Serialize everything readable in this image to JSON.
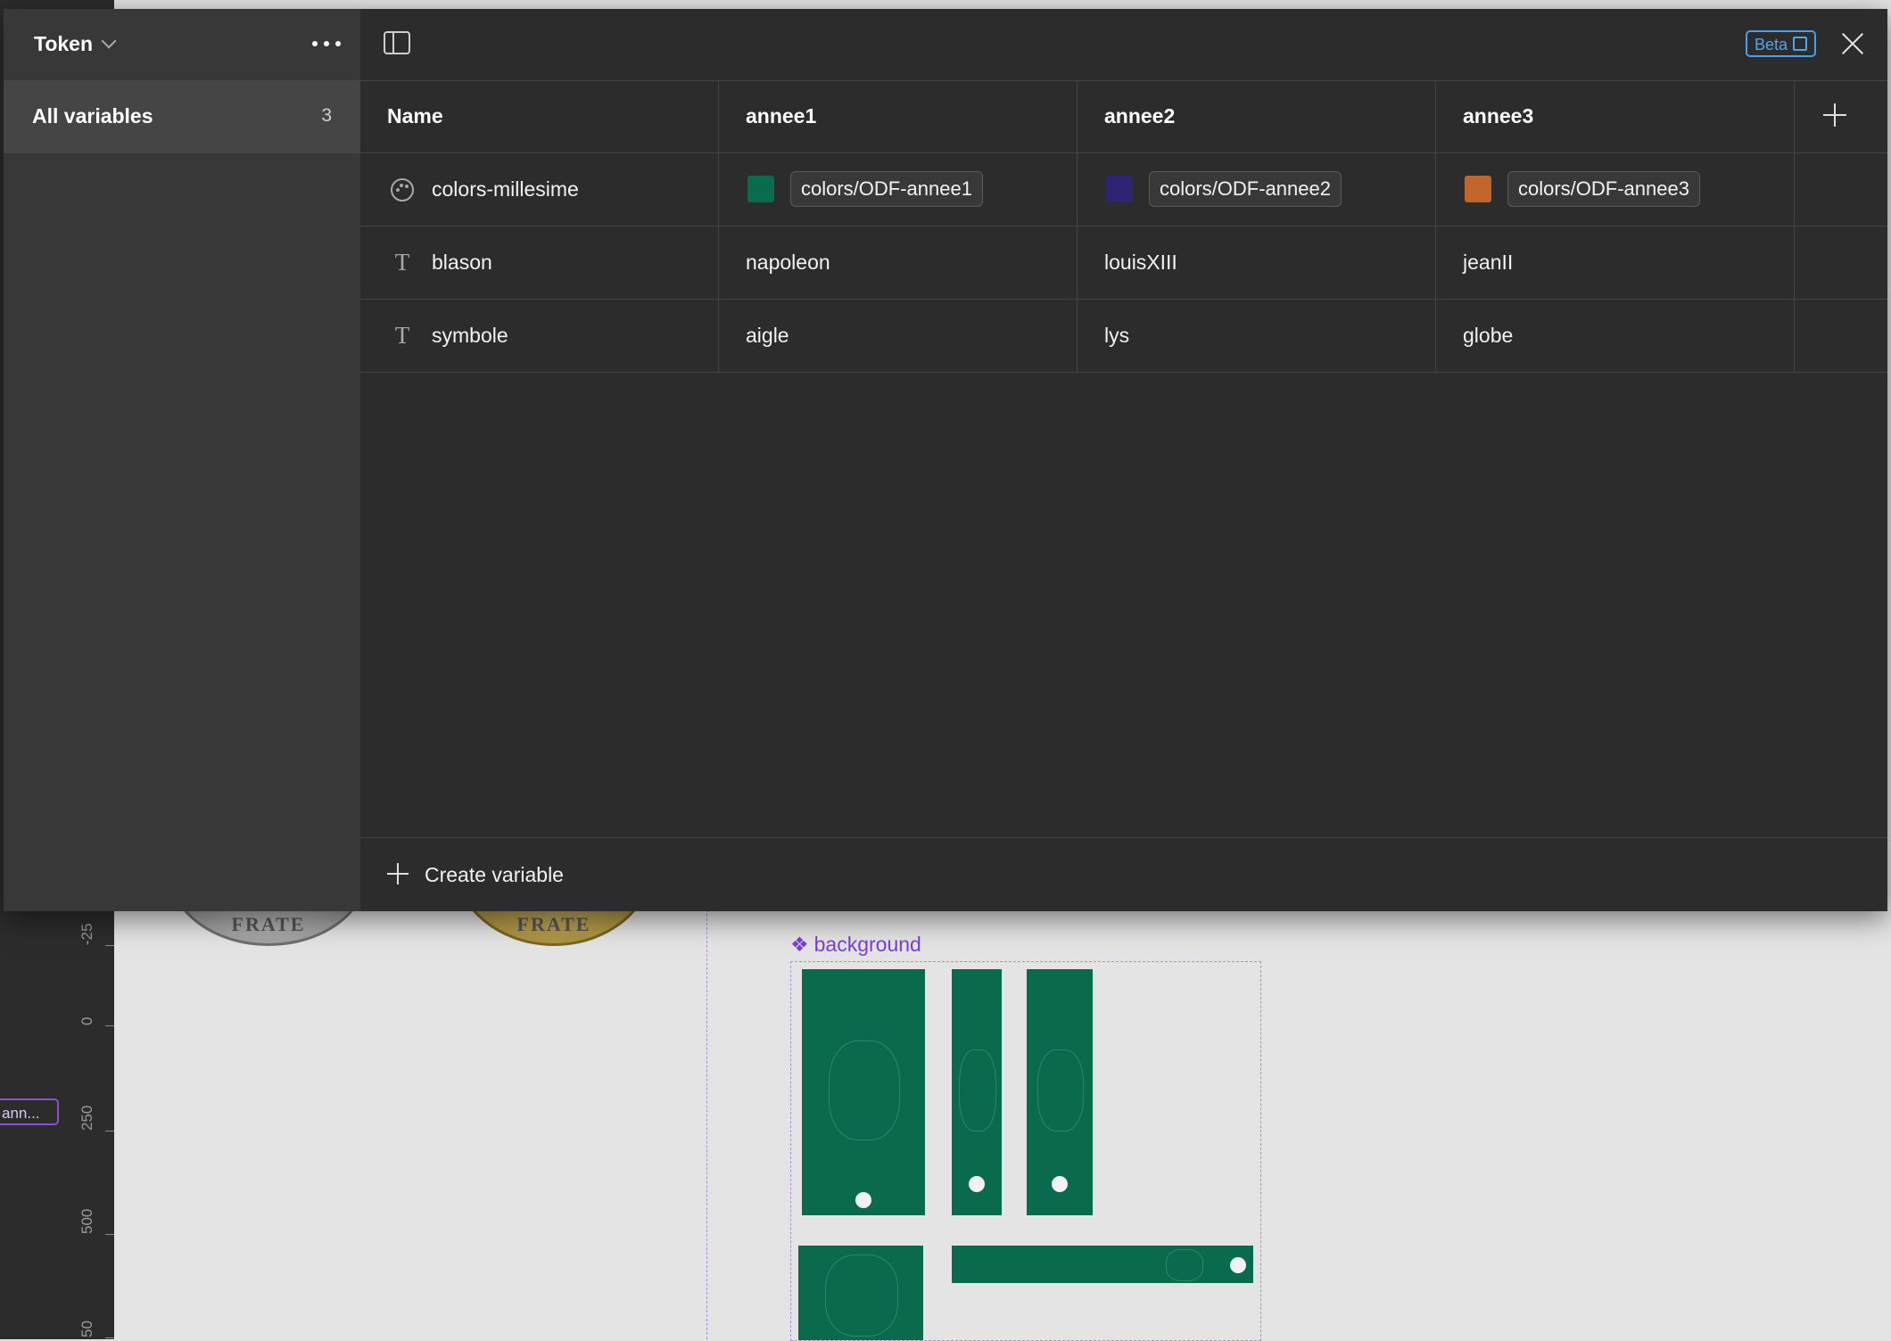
{
  "collection": {
    "title": "Token"
  },
  "sidebar": {
    "items": [
      {
        "label": "All variables",
        "count": "3"
      }
    ]
  },
  "toolbar": {
    "beta_label": "Beta"
  },
  "table": {
    "columns": [
      "Name",
      "annee1",
      "annee2",
      "annee3"
    ],
    "rows": [
      {
        "type": "color",
        "name": "colors-millesime",
        "values": [
          {
            "text": "colors/ODF-annee1",
            "color": "#0b6b4f"
          },
          {
            "text": "colors/ODF-annee2",
            "color": "#2d2573"
          },
          {
            "text": "colors/ODF-annee3",
            "color": "#c2652d"
          }
        ]
      },
      {
        "type": "string",
        "name": "blason",
        "values": [
          {
            "text": "napoleon"
          },
          {
            "text": "louisXIII"
          },
          {
            "text": "jeanII"
          }
        ]
      },
      {
        "type": "string",
        "name": "symbole",
        "values": [
          {
            "text": "aigle"
          },
          {
            "text": "lys"
          },
          {
            "text": "globe"
          }
        ]
      }
    ]
  },
  "footer": {
    "create_label": "Create variable"
  },
  "canvas": {
    "component_label": "background",
    "chip_label": "ann...",
    "coin_text": "FRATE",
    "ruler_ticks": [
      "-25",
      "0",
      "250",
      "500",
      "50"
    ]
  }
}
